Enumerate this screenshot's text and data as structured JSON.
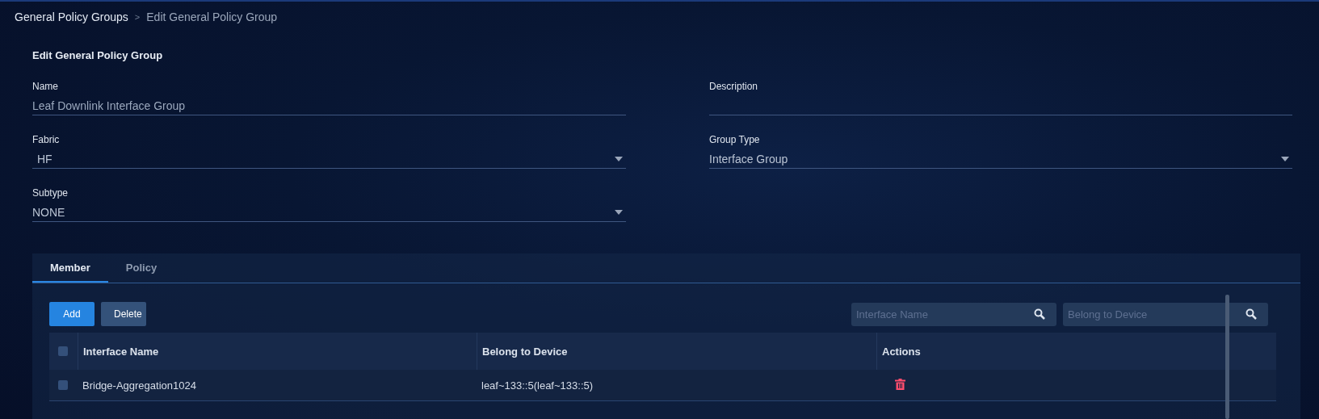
{
  "breadcrumb": [
    {
      "label": "General Policy Groups",
      "current": false
    },
    {
      "label": ">",
      "kind": "separator"
    },
    {
      "label": "Edit General Policy Group",
      "current": true
    }
  ],
  "form": {
    "title": "Edit General Policy Group",
    "fields": [
      {
        "label": "Name",
        "value": "Leaf Downlink Interface Group",
        "kind": "text"
      },
      {
        "label": "Description",
        "kind": "text"
      },
      {
        "label": "Fabric",
        "value": "HF",
        "kind": "select"
      },
      {
        "label": "Group Type",
        "value": "Interface Group",
        "kind": "select"
      },
      {
        "label": "Subtype",
        "value": "NONE",
        "kind": "select"
      }
    ]
  },
  "tabs": [
    {
      "label": "Member",
      "selected": true
    },
    {
      "label": "Policy",
      "selected": false
    }
  ],
  "buttons": [
    {
      "label": "Add",
      "kind": "primary"
    },
    {
      "label": "Delete",
      "kind": "secondary"
    }
  ],
  "search": [
    {
      "placeholder": "Interface Name"
    },
    {
      "placeholder": "Belong to Device"
    }
  ],
  "table": {
    "select_all": {
      "checked": false
    },
    "columns": [
      "Interface Name",
      "Belong to Device",
      "Actions"
    ],
    "rows": [
      {
        "checked": false,
        "cells": [
          "Bridge-Aggregation1024",
          "leaf~133::5(leaf~133::5)"
        ]
      }
    ]
  }
}
